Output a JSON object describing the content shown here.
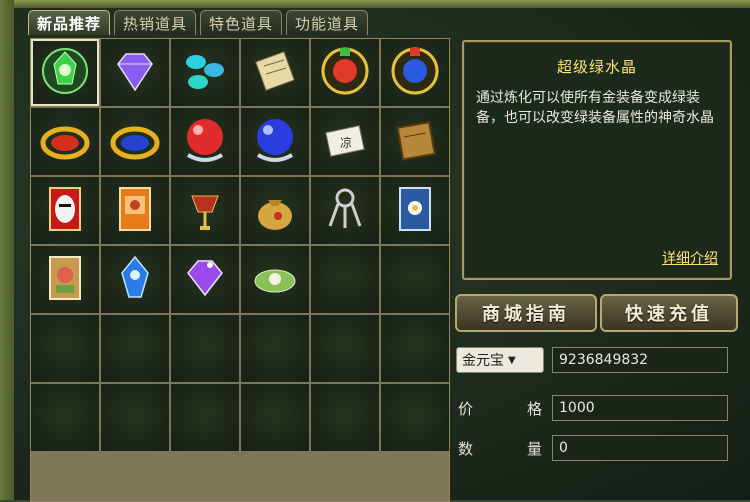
{
  "tabs": [
    {
      "label": "新品推荐",
      "active": true
    },
    {
      "label": "热销道具",
      "active": false
    },
    {
      "label": "特色道具",
      "active": false
    },
    {
      "label": "功能道具",
      "active": false
    }
  ],
  "items": [
    {
      "icon": "green-crystal-icon"
    },
    {
      "icon": "purple-diamond-icon"
    },
    {
      "icon": "blue-gems-icon"
    },
    {
      "icon": "scroll-icon"
    },
    {
      "icon": "red-orb-medallion-icon"
    },
    {
      "icon": "blue-orb-medallion-icon"
    },
    {
      "icon": "red-ring-icon"
    },
    {
      "icon": "blue-ring-icon"
    },
    {
      "icon": "red-pearl-icon"
    },
    {
      "icon": "blue-pearl-icon"
    },
    {
      "icon": "paper-note-icon"
    },
    {
      "icon": "book-icon"
    },
    {
      "icon": "opera-mask-card-icon"
    },
    {
      "icon": "orange-card-icon"
    },
    {
      "icon": "lantern-icon"
    },
    {
      "icon": "money-bag-icon"
    },
    {
      "icon": "key-ring-icon"
    },
    {
      "icon": "flower-card-icon"
    },
    {
      "icon": "portrait-card-icon"
    },
    {
      "icon": "blue-crystal-icon"
    },
    {
      "icon": "purple-crystal-icon"
    },
    {
      "icon": "leaf-plate-icon"
    }
  ],
  "detail": {
    "title": "超级绿水晶",
    "description": "通过炼化可以使所有金装备变成绿装备，也可以改变绿装备属性的神奇水晶",
    "more_link": "详细介绍"
  },
  "buttons": {
    "guide": "商城指南",
    "recharge": "快速充值"
  },
  "currency": {
    "selected": "金元宝",
    "balance": "9236849832"
  },
  "price": {
    "label": "价格",
    "value": "1000"
  },
  "quantity": {
    "label": "数量",
    "value": "0"
  }
}
